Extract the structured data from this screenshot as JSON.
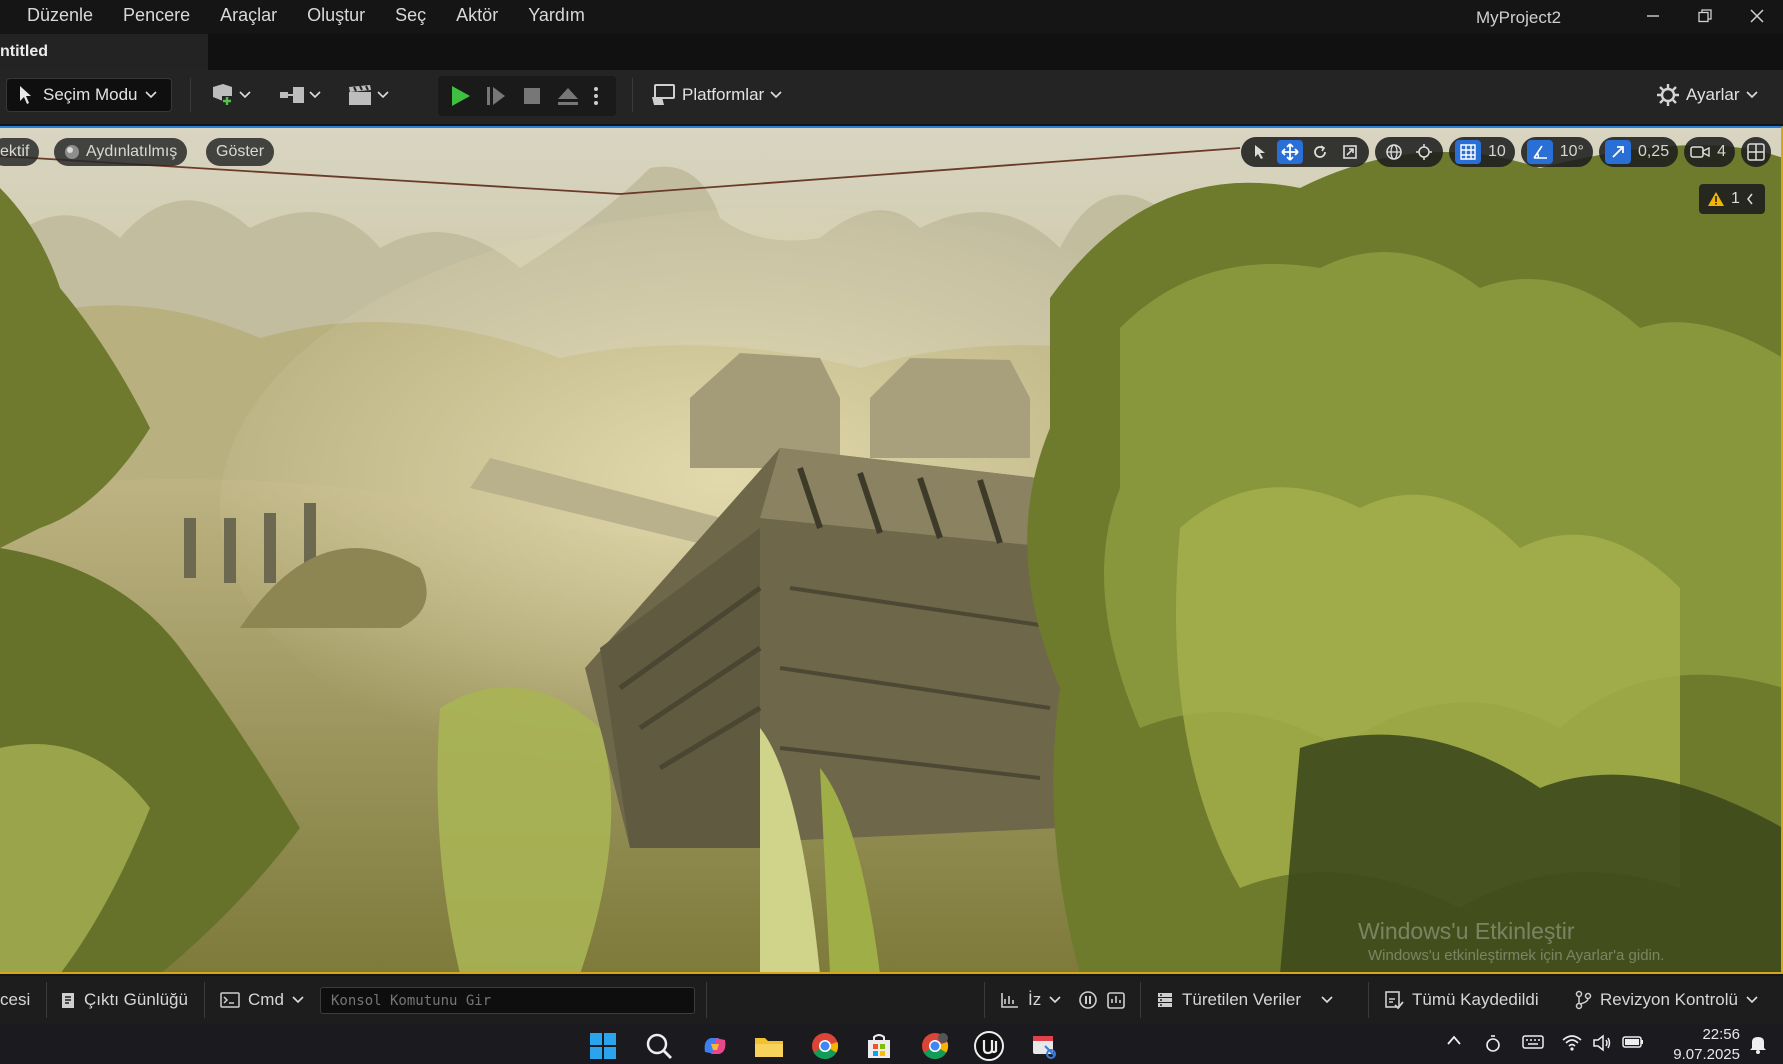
{
  "menu": {
    "items": [
      "Düzenle",
      "Pencere",
      "Araçlar",
      "Oluştur",
      "Seç",
      "Aktör",
      "Yardım"
    ],
    "app_title": "MyProject2"
  },
  "level_tab": {
    "label": "ntitled"
  },
  "toolbar": {
    "mode_label": "Seçim Modu",
    "platforms_label": "Platformlar",
    "settings_label": "Ayarlar"
  },
  "viewport": {
    "perspective_label": "ektif",
    "lit_label": "Aydınlatılmış",
    "show_label": "Göster",
    "grid_snap": "10",
    "rotation_snap": "10°",
    "scale_snap": "0,25",
    "camera_speed": "4",
    "warning_count": "1",
    "activate_title": "Windows'u Etkinleştir",
    "activate_subtitle": "Windows'u etkinleştirmek için Ayarlar'a gidin."
  },
  "statusbar": {
    "content_drawer": "cesi",
    "output_log": "Çıktı Günlüğü",
    "cmd_label": "Cmd",
    "console_placeholder": "Konsol Komutunu Gir",
    "trace_label": "İz",
    "derived_data": "Türetilen Veriler",
    "save_all": "Tümü Kaydedildi",
    "revision_control": "Revizyon Kontrolü"
  },
  "taskbar": {
    "time": "22:56",
    "date": "9.07.2025"
  },
  "colors": {
    "accent_blue": "#2a6fd6",
    "play_green": "#3fbf3f",
    "warning_yellow": "#f2b705",
    "viewport_border": "#d8a514"
  }
}
